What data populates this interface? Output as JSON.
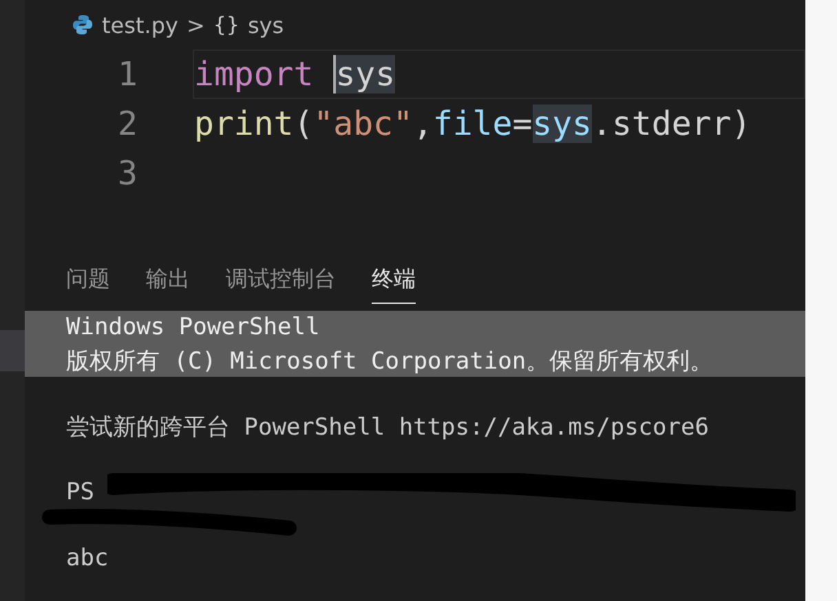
{
  "breadcrumb": {
    "file": "test.py",
    "separator": ">",
    "symbol_icon": "{}",
    "symbol": "sys"
  },
  "editor": {
    "lines": [
      {
        "number": "1",
        "current": true,
        "tokens": [
          {
            "text": "import",
            "kind": "keyword"
          },
          {
            "text": "sys",
            "kind": "plain",
            "highlighted": true,
            "cursor": true
          }
        ]
      },
      {
        "number": "2",
        "current": false,
        "tokens": [
          {
            "text": "print",
            "kind": "function"
          },
          {
            "text": "(",
            "kind": "plain"
          },
          {
            "text": "\"abc\"",
            "kind": "string"
          },
          {
            "text": ",",
            "kind": "plain"
          },
          {
            "text": "file",
            "kind": "parameter"
          },
          {
            "text": "=",
            "kind": "plain"
          },
          {
            "text": "sys",
            "kind": "parameter",
            "highlighted": true
          },
          {
            "text": ".stderr)",
            "kind": "plain"
          }
        ]
      },
      {
        "number": "3",
        "current": false
      }
    ]
  },
  "panel": {
    "tabs": [
      {
        "label": "问题",
        "selected": false
      },
      {
        "label": "输出",
        "selected": false
      },
      {
        "label": "调试控制台",
        "selected": false
      },
      {
        "label": "终端",
        "selected": true
      }
    ],
    "terminal": [
      {
        "kind": "text",
        "text": "Windows PowerShell",
        "selected": true
      },
      {
        "kind": "text",
        "text": "版权所有 (C) Microsoft Corporation。保留所有权利。",
        "selected": true
      },
      {
        "kind": "blank"
      },
      {
        "kind": "text",
        "text": "尝试新的跨平台 PowerShell https://aka.ms/pscore6",
        "selected": false
      },
      {
        "kind": "blank"
      },
      {
        "kind": "redacted",
        "text": "PS"
      },
      {
        "kind": "redacted"
      },
      {
        "kind": "text",
        "text": "abc",
        "selected": false
      }
    ]
  }
}
